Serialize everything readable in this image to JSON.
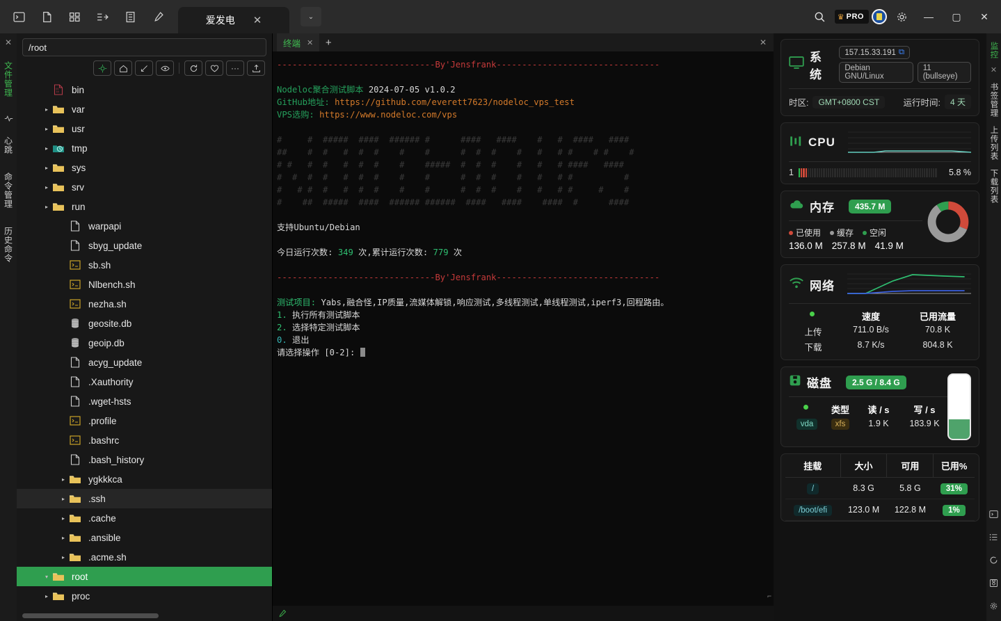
{
  "titlebar": {
    "left_icons": [
      {
        "name": "terminal-icon",
        "glyph": "▣"
      },
      {
        "name": "new-file-icon",
        "glyph": "🗋"
      },
      {
        "name": "split-layout-icon",
        "glyph": "▥"
      },
      {
        "name": "indent-icon",
        "glyph": "⊢"
      },
      {
        "name": "list-icon",
        "glyph": "☰"
      },
      {
        "name": "tools-icon",
        "glyph": "✎"
      }
    ],
    "tab": {
      "label": "爱发电",
      "close": "✕"
    },
    "tab_caret": "⌄",
    "search": "🔍",
    "pro_badge": {
      "crown": "♛",
      "text": "PRO"
    },
    "settings": "⚙",
    "minimize": "—",
    "maximize": "▢",
    "close": "✕"
  },
  "left_rail": {
    "close": "✕",
    "tabs": [
      {
        "label": "文件管理",
        "active": true
      },
      {
        "label": "心跳",
        "active": false
      },
      {
        "label": "命令管理",
        "active": false
      },
      {
        "label": "历史命令",
        "active": false
      }
    ]
  },
  "file_panel": {
    "path_value": "/root",
    "path_placeholder": "/root",
    "tools": [
      {
        "name": "locate-button",
        "glyph": "◈"
      },
      {
        "name": "home-button",
        "glyph": "⌂"
      },
      {
        "name": "collapse-button",
        "glyph": "↙"
      },
      {
        "name": "show-hidden-button",
        "glyph": "◉"
      },
      {
        "name": "refresh-button",
        "glyph": "⟳"
      },
      {
        "name": "favorite-button",
        "glyph": "♡"
      },
      {
        "name": "more-button",
        "glyph": "···"
      },
      {
        "name": "upload-button",
        "glyph": "⇪"
      }
    ],
    "tree": [
      {
        "label": "proc",
        "indent": 1,
        "icon": "folder",
        "caret": "▸",
        "state": "normal"
      },
      {
        "label": "root",
        "indent": 1,
        "icon": "folder",
        "caret": "▾",
        "state": "selected"
      },
      {
        "label": ".acme.sh",
        "indent": 2,
        "icon": "folder",
        "caret": "▸",
        "state": "normal"
      },
      {
        "label": ".ansible",
        "indent": 2,
        "icon": "folder",
        "caret": "▸",
        "state": "normal"
      },
      {
        "label": ".cache",
        "indent": 2,
        "icon": "folder",
        "caret": "▸",
        "state": "normal"
      },
      {
        "label": ".ssh",
        "indent": 2,
        "icon": "folder",
        "caret": "▸",
        "state": "hover"
      },
      {
        "label": "ygkkkca",
        "indent": 2,
        "icon": "folder",
        "caret": "▸",
        "state": "normal"
      },
      {
        "label": ".bash_history",
        "indent": 2,
        "icon": "file",
        "caret": "",
        "state": "normal"
      },
      {
        "label": ".bashrc",
        "indent": 2,
        "icon": "script",
        "caret": "",
        "state": "normal"
      },
      {
        "label": ".profile",
        "indent": 2,
        "icon": "script",
        "caret": "",
        "state": "normal"
      },
      {
        "label": ".wget-hsts",
        "indent": 2,
        "icon": "file",
        "caret": "",
        "state": "normal"
      },
      {
        "label": ".Xauthority",
        "indent": 2,
        "icon": "file",
        "caret": "",
        "state": "normal"
      },
      {
        "label": "acyg_update",
        "indent": 2,
        "icon": "file",
        "caret": "",
        "state": "normal"
      },
      {
        "label": "geoip.db",
        "indent": 2,
        "icon": "database",
        "caret": "",
        "state": "normal"
      },
      {
        "label": "geosite.db",
        "indent": 2,
        "icon": "database",
        "caret": "",
        "state": "normal"
      },
      {
        "label": "nezha.sh",
        "indent": 2,
        "icon": "script",
        "caret": "",
        "state": "normal"
      },
      {
        "label": "Nlbench.sh",
        "indent": 2,
        "icon": "script",
        "caret": "",
        "state": "normal"
      },
      {
        "label": "sb.sh",
        "indent": 2,
        "icon": "script",
        "caret": "",
        "state": "normal"
      },
      {
        "label": "sbyg_update",
        "indent": 2,
        "icon": "file",
        "caret": "",
        "state": "normal"
      },
      {
        "label": "warpapi",
        "indent": 2,
        "icon": "file",
        "caret": "",
        "state": "normal"
      },
      {
        "label": "run",
        "indent": 1,
        "icon": "folder",
        "caret": "▸",
        "state": "normal"
      },
      {
        "label": "srv",
        "indent": 1,
        "icon": "folder",
        "caret": "▸",
        "state": "normal"
      },
      {
        "label": "sys",
        "indent": 1,
        "icon": "folder",
        "caret": "▸",
        "state": "normal"
      },
      {
        "label": "tmp",
        "indent": 1,
        "icon": "temp",
        "caret": "▸",
        "state": "normal"
      },
      {
        "label": "usr",
        "indent": 1,
        "icon": "folder",
        "caret": "▸",
        "state": "normal"
      },
      {
        "label": "var",
        "indent": 1,
        "icon": "folder",
        "caret": "▸",
        "state": "normal"
      },
      {
        "label": "bin",
        "indent": 1,
        "icon": "binary",
        "caret": "",
        "state": "normal"
      }
    ]
  },
  "terminal": {
    "tab_label": "终端",
    "tab_close": "✕",
    "add_tab": "+",
    "panel_close": "✕",
    "divider_top": "-------------------------------By'Jensfrank--------------------------------",
    "script_name": "Nodeloc聚合测试脚本",
    "script_date": "2024-07-05",
    "script_version": "v1.0.2",
    "github_label": "GitHub地址:",
    "github_url": "https://github.com/everett7623/nodeloc_vps_test",
    "vps_label": "VPS选购:",
    "vps_url": "https://www.nodeloc.com/vps",
    "ascii_art": [
      "#     #  #####  ####  ###### #      ####   ####    #   #  ####   ####",
      "##    #  #   #  #  #    #    #      #  #  #    #   #   # #    # #    #",
      "# #   #  #   #  #  #    #    #####  #  #  #    #   #   # ####   ####",
      "#  #  #  #   #  #  #    #    #      #  #  #    #   #   # #          #",
      "#   # #  #   #  #  #    #    #      #  #  #    #   #   # #     #    #",
      "#    ##  #####  ####  ###### ######  ####   ####    ####  #      ####"
    ],
    "support": "支持Ubuntu/Debian",
    "runs_prefix": "今日运行次数:",
    "runs_today": "349",
    "runs_mid": "次,累计运行次数:",
    "runs_total": "779",
    "runs_suffix": "次",
    "divider_bottom": "-------------------------------By'Jensfrank--------------------------------",
    "test_items_label": "测试项目:",
    "test_items": "Yabs,融合怪,IP质量,流媒体解锁,响应测试,多线程测试,单线程测试,iperf3,回程路由。",
    "menu": [
      {
        "num": "1.",
        "text": "执行所有测试脚本"
      },
      {
        "num": "2.",
        "text": "选择特定测试脚本"
      },
      {
        "num": "0.",
        "text": "退出"
      }
    ],
    "prompt": "请选择操作 [0-2]:"
  },
  "monitor": {
    "system": {
      "title": "系统",
      "icon": "monitor-icon",
      "ip": "157.15.33.191",
      "copy_icon": "⧉",
      "os": "Debian GNU/Linux",
      "os_version": "11 (bullseye)",
      "timezone_label": "时区:",
      "timezone_value": "GMT+0800  CST",
      "uptime_label": "运行时间:",
      "uptime_value": "4 天"
    },
    "cpu": {
      "title": "CPU",
      "core_label": "1",
      "usage": "5.8 %",
      "usage_pct": 5.8
    },
    "memory": {
      "title": "内存",
      "total_badge": "435.7 M",
      "legend": [
        {
          "label": "已使用",
          "value": "136.0 M",
          "color": "#d04a3a"
        },
        {
          "label": "缓存",
          "value": "257.8 M",
          "color": "#9a9a9a"
        },
        {
          "label": "空闲",
          "value": "41.9 M",
          "color": "#2f9e4f"
        }
      ]
    },
    "network": {
      "title": "网络",
      "col_speed": "速度",
      "col_traffic": "已用流量",
      "rows": [
        {
          "label": "上传",
          "speed": "711.0 B/s",
          "traffic": "70.8 K"
        },
        {
          "label": "下载",
          "speed": "8.7 K/s",
          "traffic": "804.8 K"
        }
      ]
    },
    "disk": {
      "title": "磁盘",
      "usage_badge": "2.5 G / 8.4 G",
      "col_type": "类型",
      "col_read": "读 / s",
      "col_write": "写 / s",
      "device": "vda",
      "fstype": "xfs",
      "read": "1.9 K",
      "write": "183.9 K",
      "gauge_pct": 30
    },
    "mounts": {
      "headers": [
        "挂载",
        "大小",
        "可用",
        "已用%"
      ],
      "rows": [
        {
          "mount": "/",
          "size": "8.3 G",
          "avail": "5.8 G",
          "used": "31%"
        },
        {
          "mount": "/boot/efi",
          "size": "123.0 M",
          "avail": "122.8 M",
          "used": "1%"
        }
      ]
    }
  },
  "right_rail": {
    "tabs": [
      {
        "label": "监控",
        "active": true
      },
      {
        "label": "书签管理",
        "active": false
      },
      {
        "label": "上传列表",
        "active": false
      },
      {
        "label": "下载列表",
        "active": false
      }
    ],
    "close": "✕",
    "bottom_icons": [
      {
        "name": "terminal-icon",
        "glyph": "▣"
      },
      {
        "name": "list-icon",
        "glyph": "☰"
      },
      {
        "name": "refresh-icon",
        "glyph": "⟳"
      },
      {
        "name": "save-icon",
        "glyph": "🖫"
      },
      {
        "name": "settings-icon",
        "glyph": "⚙"
      }
    ]
  },
  "colors": {
    "accent_green": "#2f9e4f",
    "red": "#c63a3a",
    "orange": "#d47a2a",
    "cyan": "#36b6b6"
  },
  "chart_data": [
    {
      "type": "line",
      "title": "CPU",
      "series": [
        {
          "name": "cpu",
          "values": [
            0,
            0,
            0,
            5.8,
            5.8,
            5.2,
            4.9
          ]
        }
      ],
      "ylim": [
        0,
        100
      ],
      "grid": true
    },
    {
      "type": "pie",
      "title": "内存",
      "categories": [
        "已使用",
        "缓存",
        "空闲"
      ],
      "values": [
        136.0,
        257.8,
        41.9
      ],
      "colors": [
        "#d04a3a",
        "#9a9a9a",
        "#2f9e4f"
      ]
    },
    {
      "type": "line",
      "title": "网络",
      "series": [
        {
          "name": "下载",
          "values": [
            0,
            0,
            30,
            78,
            70,
            68
          ]
        },
        {
          "name": "上传",
          "values": [
            0,
            0,
            8,
            14,
            13,
            13
          ]
        }
      ],
      "grid": true
    }
  ]
}
